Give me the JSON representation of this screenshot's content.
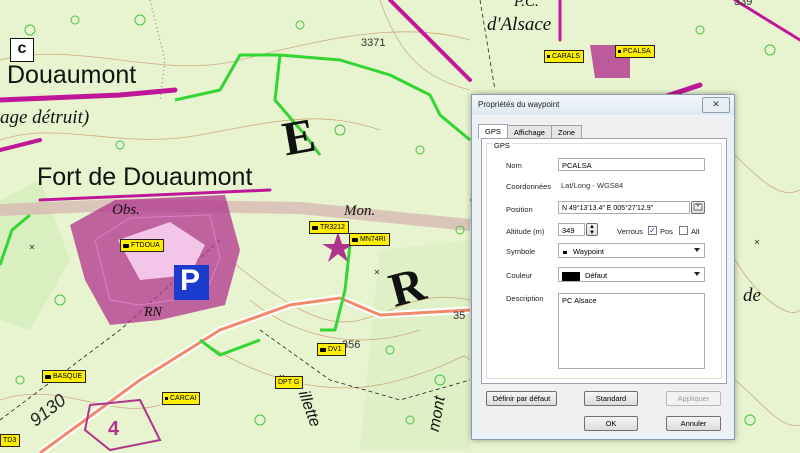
{
  "map": {
    "place_labels": {
      "douaumont": "Douaumont",
      "village_detruit": "age détruit)",
      "fort": "Fort de Douaumont",
      "obs": "Obs.",
      "mon": "Mon.",
      "alsace": "d'Alsace",
      "pc": "P.C.",
      "rn": "RN",
      "de": "de",
      "letter_e": "E",
      "letter_r": "R",
      "letter_c": "c",
      "parking": "P",
      "grid_4": "4",
      "road_9130": "9130",
      "alt_3371": "3371",
      "alt_339": "339",
      "alt_356": "356",
      "alt_35": "35",
      "illette": "illette",
      "mont": "mont"
    },
    "waypoints": {
      "fdoua": "FTDOUA",
      "tr3212": "TR3212",
      "mn74ri": "MN74RI",
      "carals": "CARALS",
      "pcalsa": "PCALSA",
      "basque": "BASQUE",
      "carcai": "CARCAI",
      "dv1": "DV1",
      "dptg": "DPT G",
      "td3": "TD3"
    }
  },
  "dialog": {
    "title": "Propriétés du waypoint",
    "close_glyph": "✕",
    "tabs": [
      "GPS",
      "Affichage",
      "Zone"
    ],
    "group_title": "GPS",
    "nom_label": "Nom",
    "nom_value": "PCALSA",
    "coord_label": "Coordonnées",
    "coord_value": "Lat/Long - WGS84",
    "position_label": "Position",
    "position_value": "N 49°13'13.4\" E 005°27'12.9\"",
    "altitude_label": "Altitude (m)",
    "altitude_value": "349",
    "verrous_label": "Verrous",
    "pos_label": "Pos",
    "alt_label": "Alt",
    "symbole_label": "Symbole",
    "symbole_value": "Waypoint",
    "couleur_label": "Couleur",
    "couleur_value": "Défaut",
    "description_label": "Description",
    "description_value": "PC Alsace",
    "btn_definir": "Définir par défaut",
    "btn_standard": "Standard",
    "btn_appliquer": "Appliquer",
    "btn_ok": "OK",
    "btn_annuler": "Annuler"
  },
  "colors": {
    "magenta_trail": "#c0179a",
    "green_trail": "#33d633",
    "map_bg": "#e8f3cf",
    "waypoint_label": "#ffee00"
  }
}
